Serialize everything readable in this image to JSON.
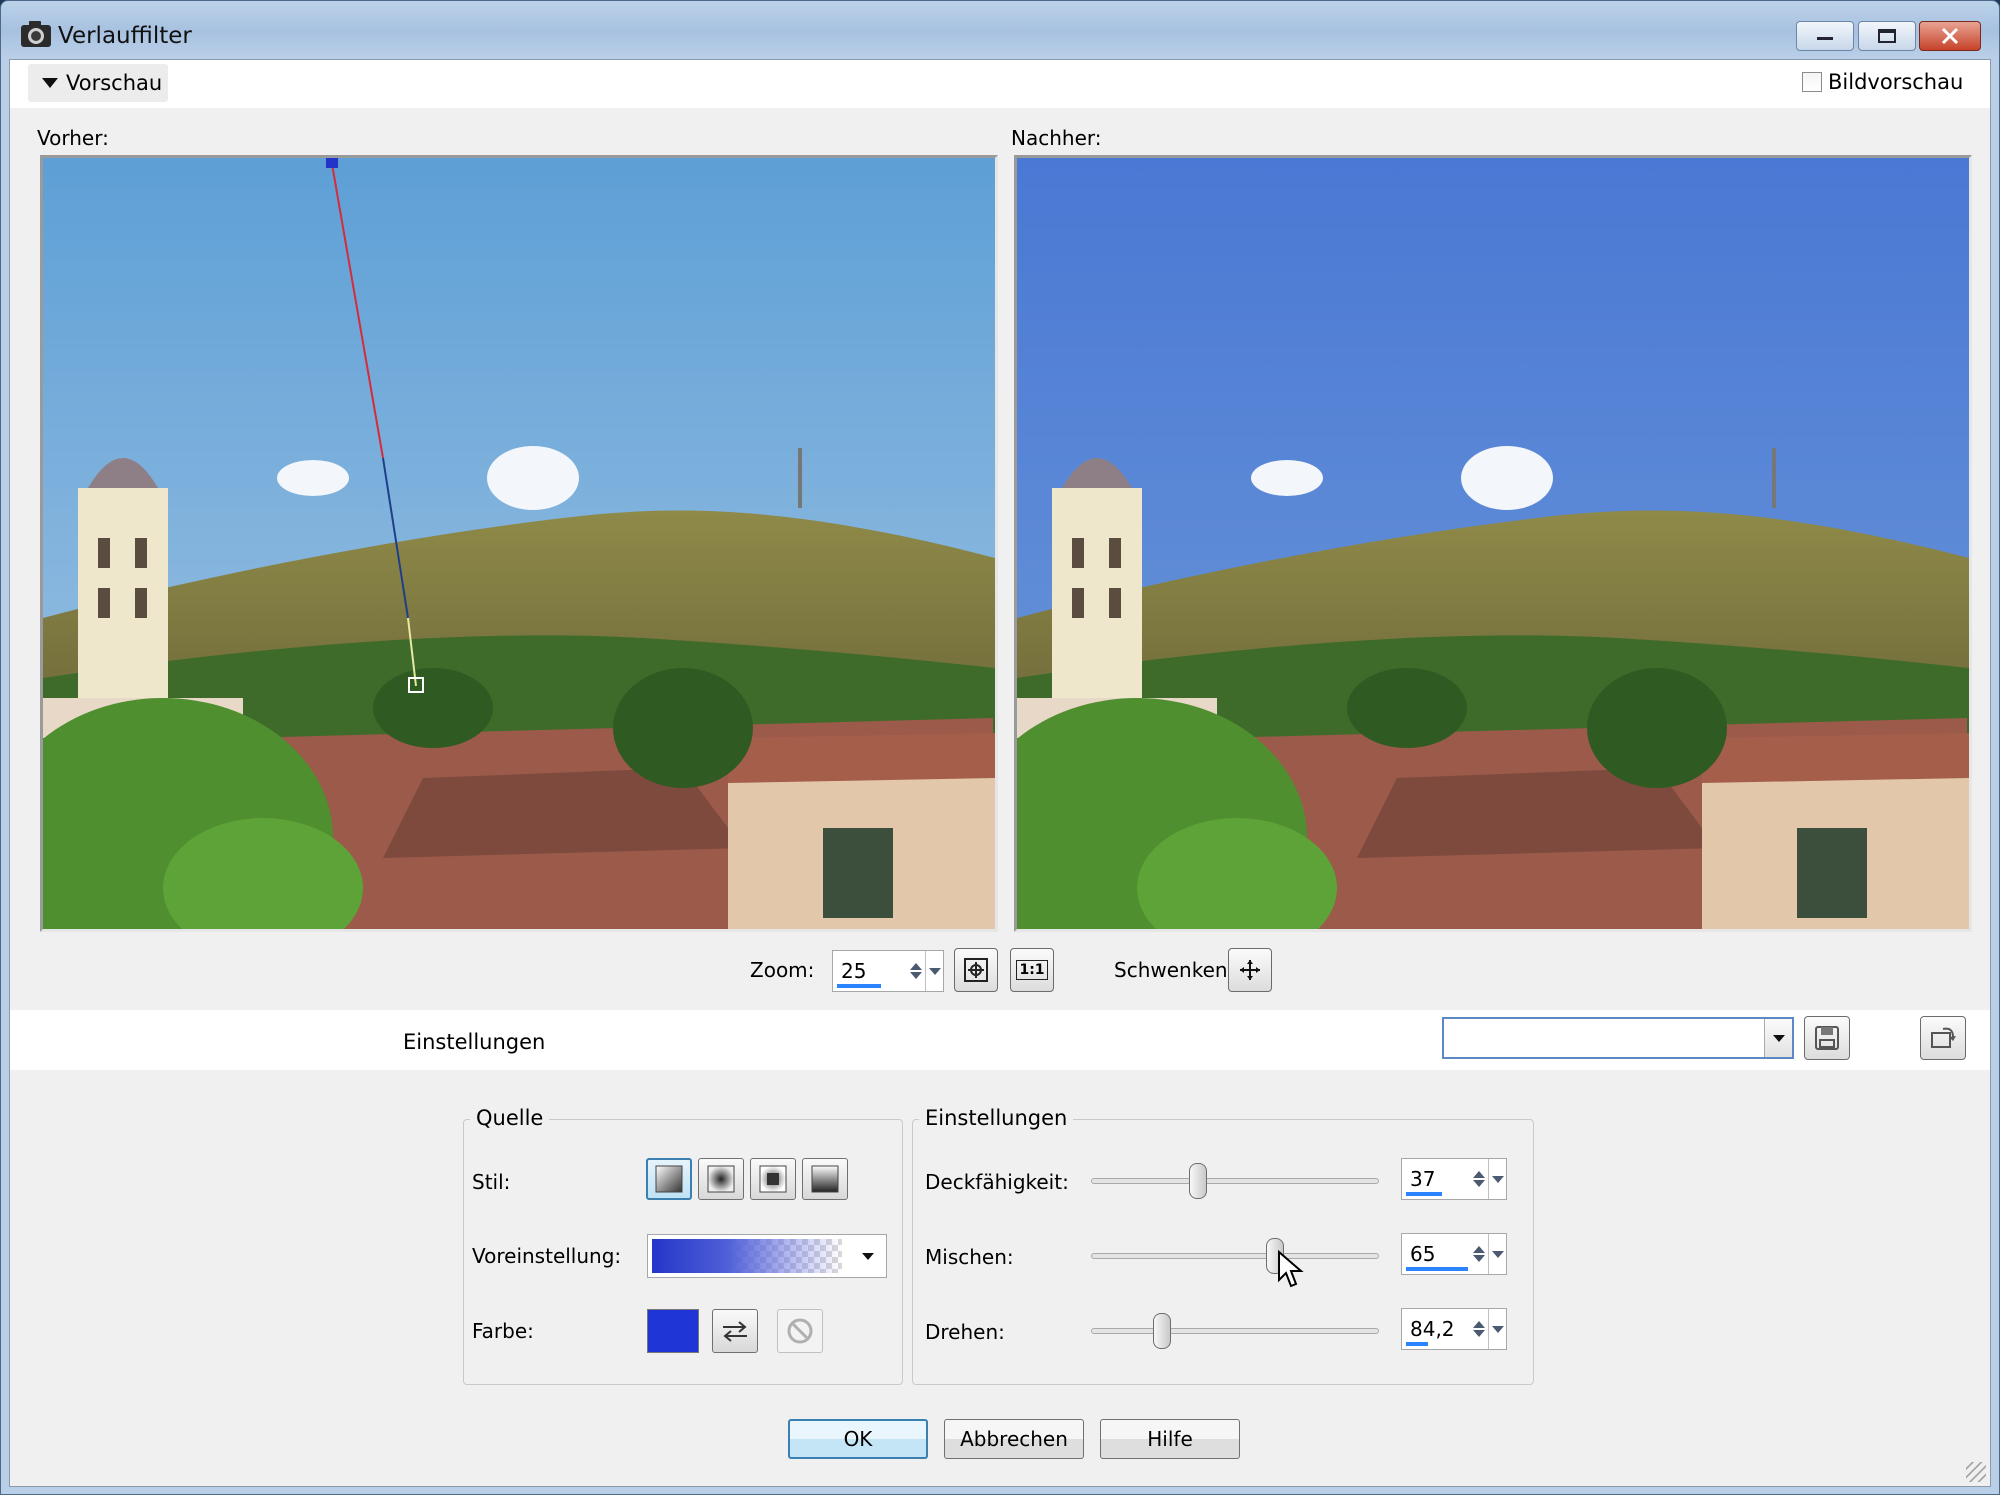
{
  "window": {
    "title": "Verlauffilter",
    "icon": "camera-icon"
  },
  "preview": {
    "toggle_label": "Vorschau",
    "image_preview_label": "Bildvorschau",
    "image_preview_checked": false,
    "before_label": "Vorher:",
    "after_label": "Nachher:"
  },
  "zoom": {
    "label": "Zoom:",
    "value": "25",
    "pan_label": "Schwenken:",
    "fit_icon": "zoom-fit-icon",
    "actual_size_label": "1:1"
  },
  "settings_header": {
    "title": "Einstellungen",
    "preset_value": ""
  },
  "source": {
    "title": "Quelle",
    "style_label": "Stil:",
    "styles": [
      "linear",
      "radial",
      "rectangular",
      "elliptical"
    ],
    "active_style": 0,
    "preset_label": "Voreinstellung:",
    "color_label": "Farbe:",
    "color": "#1f35d6"
  },
  "adjust": {
    "title": "Einstellungen",
    "opacity": {
      "label": "Deckfähigkeit:",
      "value": "37",
      "fraction": 0.37
    },
    "blend": {
      "label": "Mischen:",
      "value": "65",
      "fraction": 0.65
    },
    "rotate": {
      "label": "Drehen:",
      "value": "84,2",
      "fraction": 0.234
    }
  },
  "buttons": {
    "ok": "OK",
    "cancel": "Abbrechen",
    "help": "Hilfe"
  }
}
